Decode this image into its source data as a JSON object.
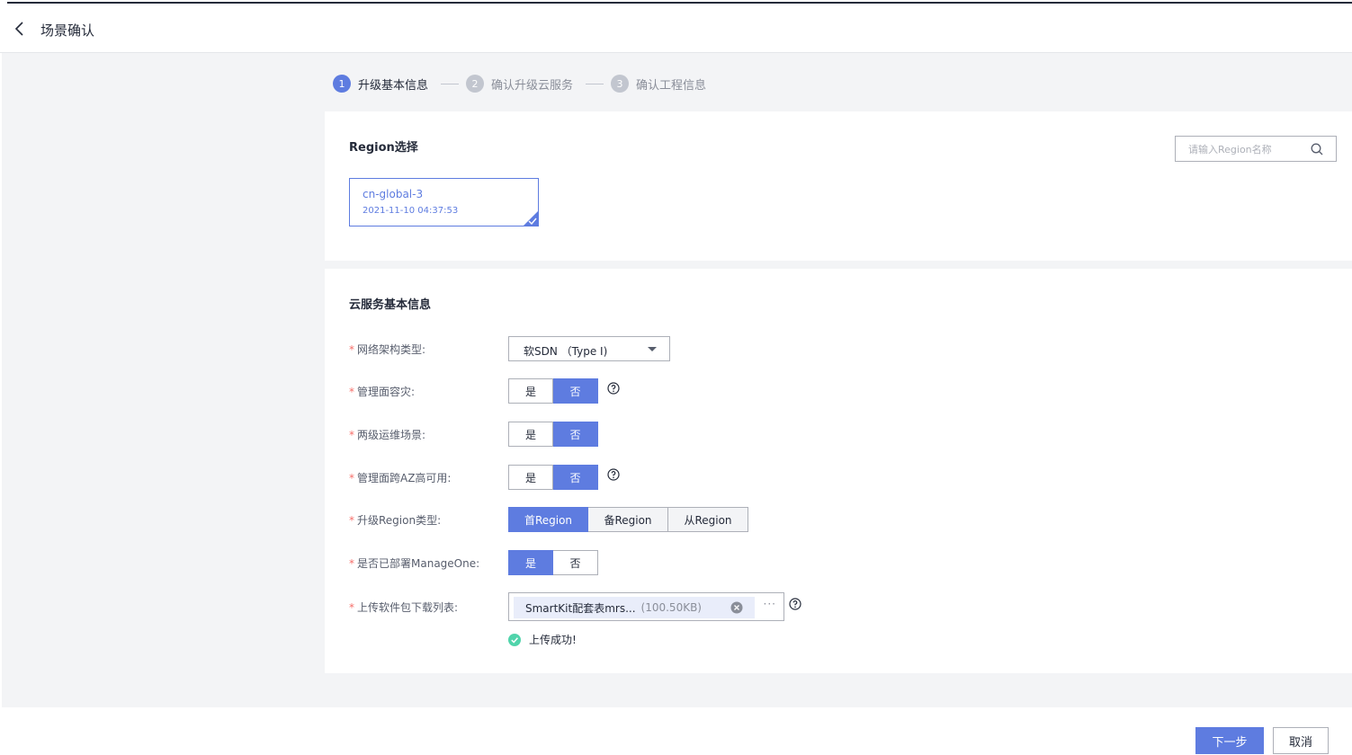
{
  "header": {
    "title": "场景确认"
  },
  "steps": [
    {
      "num": "1",
      "label": "升级基本信息"
    },
    {
      "num": "2",
      "label": "确认升级云服务"
    },
    {
      "num": "3",
      "label": "确认工程信息"
    }
  ],
  "region_section": {
    "title": "Region选择",
    "search_placeholder": "请输入Region名称",
    "card": {
      "name": "cn-global-3",
      "time": "2021-11-10 04:37:53"
    }
  },
  "cloud_section": {
    "title": "云服务基本信息",
    "fields": {
      "network": {
        "label": "网络架构类型:",
        "value": "软SDN （Type I)"
      },
      "dr": {
        "label": "管理面容灾:",
        "options": [
          "是",
          "否"
        ],
        "selected": "否"
      },
      "ops": {
        "label": "两级运维场景:",
        "options": [
          "是",
          "否"
        ],
        "selected": "否"
      },
      "az": {
        "label": "管理面跨AZ高可用:",
        "options": [
          "是",
          "否"
        ],
        "selected": "否"
      },
      "region_type": {
        "label": "升级Region类型:",
        "options": [
          "首Region",
          "备Region",
          "从Region"
        ],
        "selected": "首Region"
      },
      "manageone": {
        "label": "是否已部署ManageOne:",
        "options": [
          "是",
          "否"
        ],
        "selected": "是"
      },
      "upload": {
        "label": "上传软件包下载列表:",
        "file_name": "SmartKit配套表mrs...",
        "file_size": "(100.50KB)",
        "more": "···",
        "status": "上传成功!"
      }
    },
    "required_mark": "*"
  },
  "footer": {
    "next_label": "下一步",
    "cancel_label": "取消"
  },
  "colors": {
    "primary": "#5e7ce0",
    "success": "#50d4ab",
    "required": "#f66f6a"
  }
}
